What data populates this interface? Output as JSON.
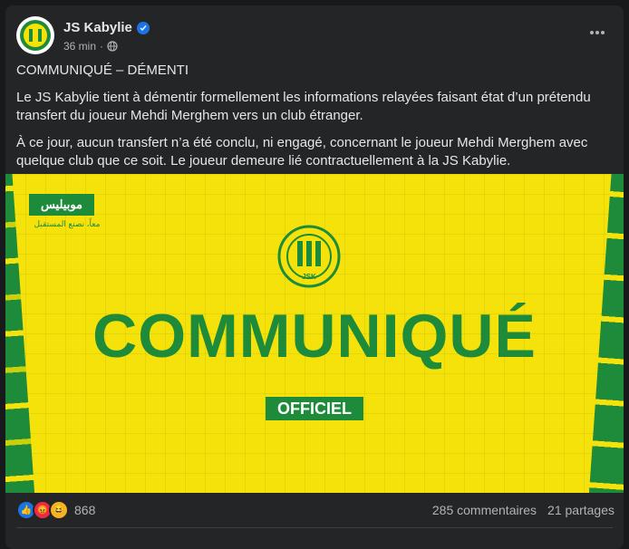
{
  "post": {
    "page_name": "JS Kabylie",
    "time": "36 min",
    "title": "COMMUNIQUÉ – DÉMENTI",
    "paragraph_1": "Le JS Kabylie tient à démentir formellement les informations relayées faisant état d’un prétendu transfert du joueur Mehdi Merghem vers un club étranger.",
    "paragraph_2": "À ce jour, aucun transfert n’a été conclu, ni engagé, concernant le joueur Mehdi Merghem avec quelque club que ce soit. Le joueur demeure lié contractuellement à la JS Kabylie."
  },
  "banner": {
    "sponsor": "موبيليس",
    "sponsor_tagline": "معاً، نصنع المستقبل",
    "crest_text": "JSK",
    "headline": "COMMUNIQUÉ",
    "badge": "OFFICIEL"
  },
  "footer": {
    "reaction_count": "868",
    "comments": "285 commentaires",
    "shares": "21 partages"
  },
  "colors": {
    "jsk_green": "#1e8b3b",
    "jsk_yellow": "#f4e20a",
    "like_blue": "#1b74e4"
  }
}
